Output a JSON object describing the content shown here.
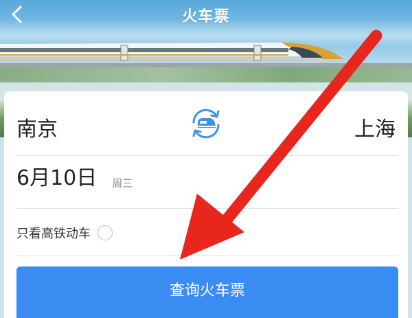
{
  "header": {
    "title": "火车票",
    "back_icon": "chevron-left-icon"
  },
  "route": {
    "from": "南京",
    "to": "上海",
    "swap_icon": "train-swap-icon"
  },
  "date": {
    "value": "6月10日",
    "weekday": "周三"
  },
  "filter": {
    "label": "只看高铁动车",
    "checked": false
  },
  "search": {
    "label": "查询火车票"
  },
  "colors": {
    "accent": "#3a8bf2",
    "swap_icon": "#3c92e6",
    "annotation_arrow": "#e8261e"
  }
}
